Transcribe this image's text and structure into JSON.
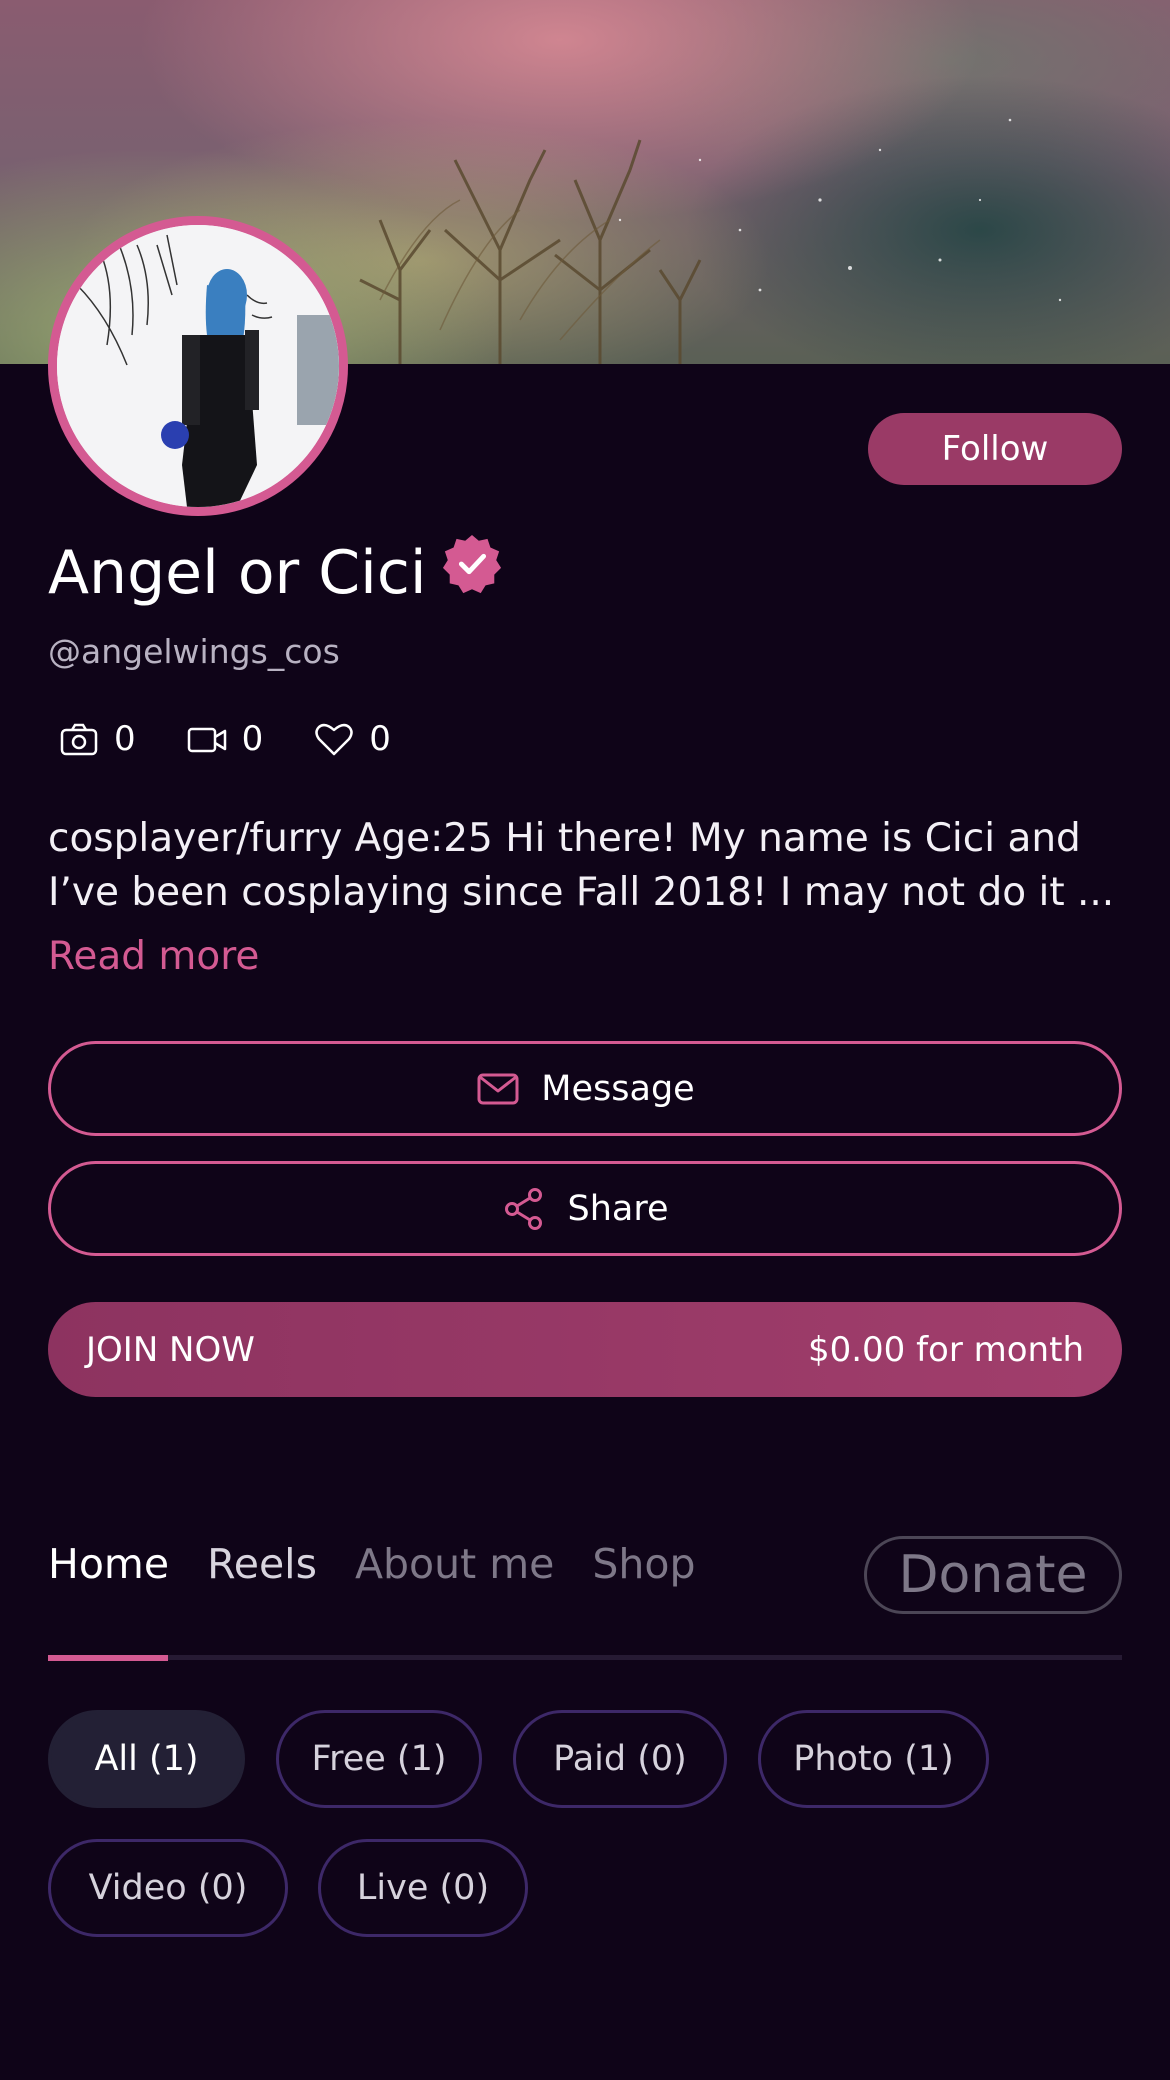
{
  "header": {
    "cover_alt": "aurora cover photo",
    "follow_label": "Follow"
  },
  "profile": {
    "name": "Angel or Cici",
    "handle": "@angelwings_cos",
    "verified": true,
    "stats": [
      {
        "icon": "camera-icon",
        "value": "0"
      },
      {
        "icon": "video-icon",
        "value": "0"
      },
      {
        "icon": "heart-icon",
        "value": "0"
      }
    ],
    "bio_line1": "cosplayer/furry Age:25 Hi there! My name is Cici and",
    "bio_line2": "I’ve been cosplaying since Fall 2018! I may not do it ...",
    "read_more": "Read more"
  },
  "actions": {
    "message_label": "Message",
    "share_label": "Share",
    "join_label": "JOIN NOW",
    "join_price": "$0.00 for month"
  },
  "tabs": [
    {
      "label": "Home",
      "active": true
    },
    {
      "label": "Reels",
      "active": false
    },
    {
      "label": "About me",
      "active": false
    },
    {
      "label": "Shop",
      "active": false
    }
  ],
  "donate_label": "Donate",
  "filters": [
    {
      "label": "All",
      "count": "(1)",
      "active": true
    },
    {
      "label": "Free",
      "count": "(1)",
      "active": false
    },
    {
      "label": "Paid",
      "count": "(0)",
      "active": false
    },
    {
      "label": "Photo",
      "count": "(1)",
      "active": false
    },
    {
      "label": "Video",
      "count": "(0)",
      "active": false
    },
    {
      "label": "Live",
      "count": "(0)",
      "active": false
    }
  ],
  "colors": {
    "background": "#0f0418",
    "accent": "#d45a92",
    "button_fill": "#9a3a66",
    "chip_border": "#3d2868"
  }
}
